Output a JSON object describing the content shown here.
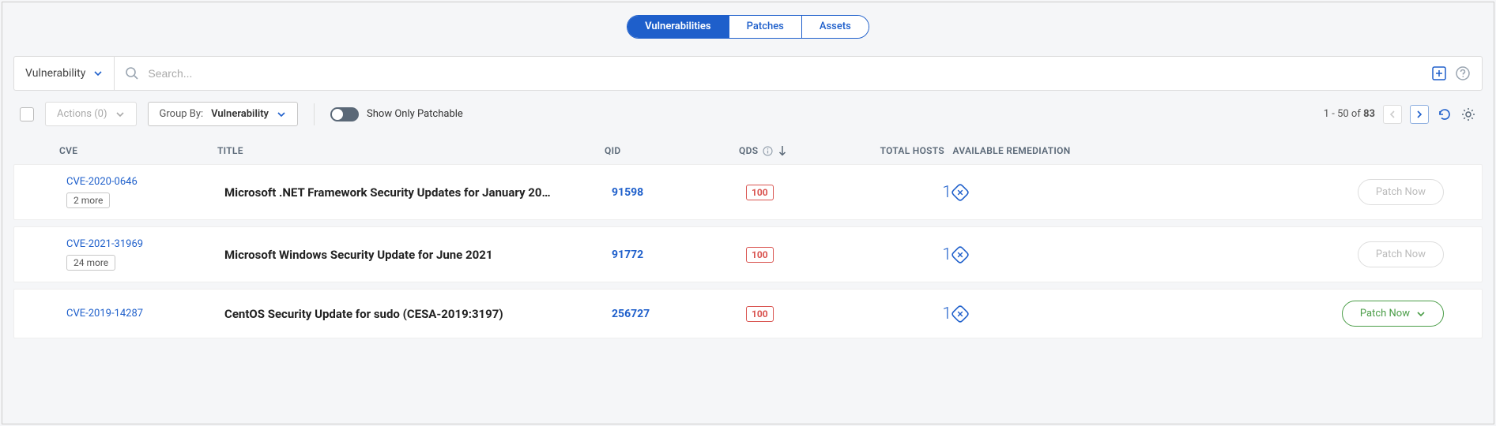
{
  "tabs": {
    "vulnerabilities": "Vulnerabilities",
    "patches": "Patches",
    "assets": "Assets"
  },
  "filter": {
    "label": "Vulnerability"
  },
  "search": {
    "placeholder": "Search..."
  },
  "toolbar": {
    "actions_label": "Actions (0)",
    "groupby_prefix": "Group By: ",
    "groupby_value": "Vulnerability",
    "toggle_label": "Show Only Patchable",
    "paging_range": "1 - 50",
    "paging_of": " of ",
    "paging_total": "83"
  },
  "columns": {
    "cve": "CVE",
    "title": "TITLE",
    "qid": "QID",
    "qds": "QDS",
    "hosts": "TOTAL HOSTS",
    "remediation": "AVAILABLE REMEDIATION"
  },
  "rows": [
    {
      "cve": "CVE-2020-0646",
      "more": "2 more",
      "title": "Microsoft .NET Framework Security Updates for January 20…",
      "qid": "91598",
      "qds": "100",
      "hosts": "1",
      "patch_label": "Patch Now",
      "patch_enabled": false
    },
    {
      "cve": "CVE-2021-31969",
      "more": "24 more",
      "title": "Microsoft Windows Security Update for June 2021",
      "qid": "91772",
      "qds": "100",
      "hosts": "1",
      "patch_label": "Patch Now",
      "patch_enabled": false
    },
    {
      "cve": "CVE-2019-14287",
      "more": "",
      "title": "CentOS Security Update for sudo (CESA-2019:3197)",
      "qid": "256727",
      "qds": "100",
      "hosts": "1",
      "patch_label": "Patch Now",
      "patch_enabled": true
    }
  ]
}
